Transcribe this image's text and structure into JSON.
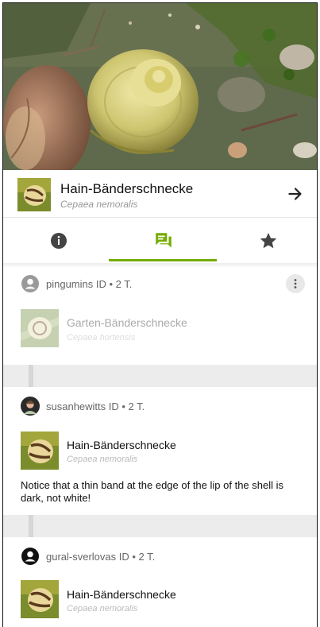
{
  "species": {
    "common_name": "Hain-Bänderschnecke",
    "scientific_name": "Cepaea nemoralis"
  },
  "tabs": [
    {
      "name": "info-icon",
      "active": false
    },
    {
      "name": "chat-icon",
      "active": true
    },
    {
      "name": "star-icon",
      "active": false
    }
  ],
  "colors": {
    "accent": "#74ac00",
    "muted": "#999999",
    "divider": "#ececec"
  },
  "activity": [
    {
      "user": "pingumins",
      "meta": "pingumins ID • 2 T.",
      "avatar": "person-circle-icon",
      "common_name": "Garten-Bänderschnecke",
      "scientific_name": "Cepaea hortensis",
      "withdrawn": true
    },
    {
      "user": "susanhewitts",
      "meta": "susanhewitts ID • 2 T.",
      "avatar": "photo-avatar",
      "common_name": "Hain-Bänderschnecke",
      "scientific_name": "Cepaea nemoralis",
      "comment": "Notice that a thin band at the edge of the lip of the shell is dark, not white!"
    },
    {
      "user": "gural-sverlovas",
      "meta": "gural-sverlovas ID • 2 T.",
      "avatar": "person-circle-icon",
      "common_name": "Hain-Bänderschnecke",
      "scientific_name": "Cepaea nemoralis"
    }
  ]
}
